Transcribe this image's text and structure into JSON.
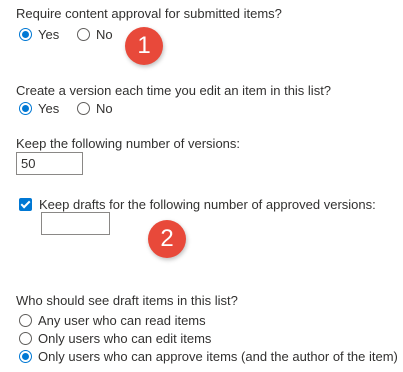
{
  "approval": {
    "question": "Require content approval for submitted items?",
    "options": [
      {
        "label": "Yes",
        "selected": true
      },
      {
        "label": "No",
        "selected": false
      }
    ]
  },
  "versioning": {
    "question": "Create a version each time you edit an item in this list?",
    "options": [
      {
        "label": "Yes",
        "selected": true
      },
      {
        "label": "No",
        "selected": false
      }
    ]
  },
  "version_limit": {
    "label": "Keep the following number of versions:",
    "value": "50"
  },
  "draft_limit": {
    "checkbox_label": "Keep drafts for the following number of approved versions:",
    "checked": true,
    "value": ""
  },
  "draft_visibility": {
    "question": "Who should see draft items in this list?",
    "options": [
      {
        "label": "Any user who can read items",
        "selected": false
      },
      {
        "label": "Only users who can edit items",
        "selected": false
      },
      {
        "label": "Only users who can approve items (and the author of the item)",
        "selected": true
      }
    ]
  },
  "badges": {
    "first": "1",
    "second": "2"
  },
  "colors": {
    "accent": "#0078d4",
    "badge": "#e8493a"
  }
}
